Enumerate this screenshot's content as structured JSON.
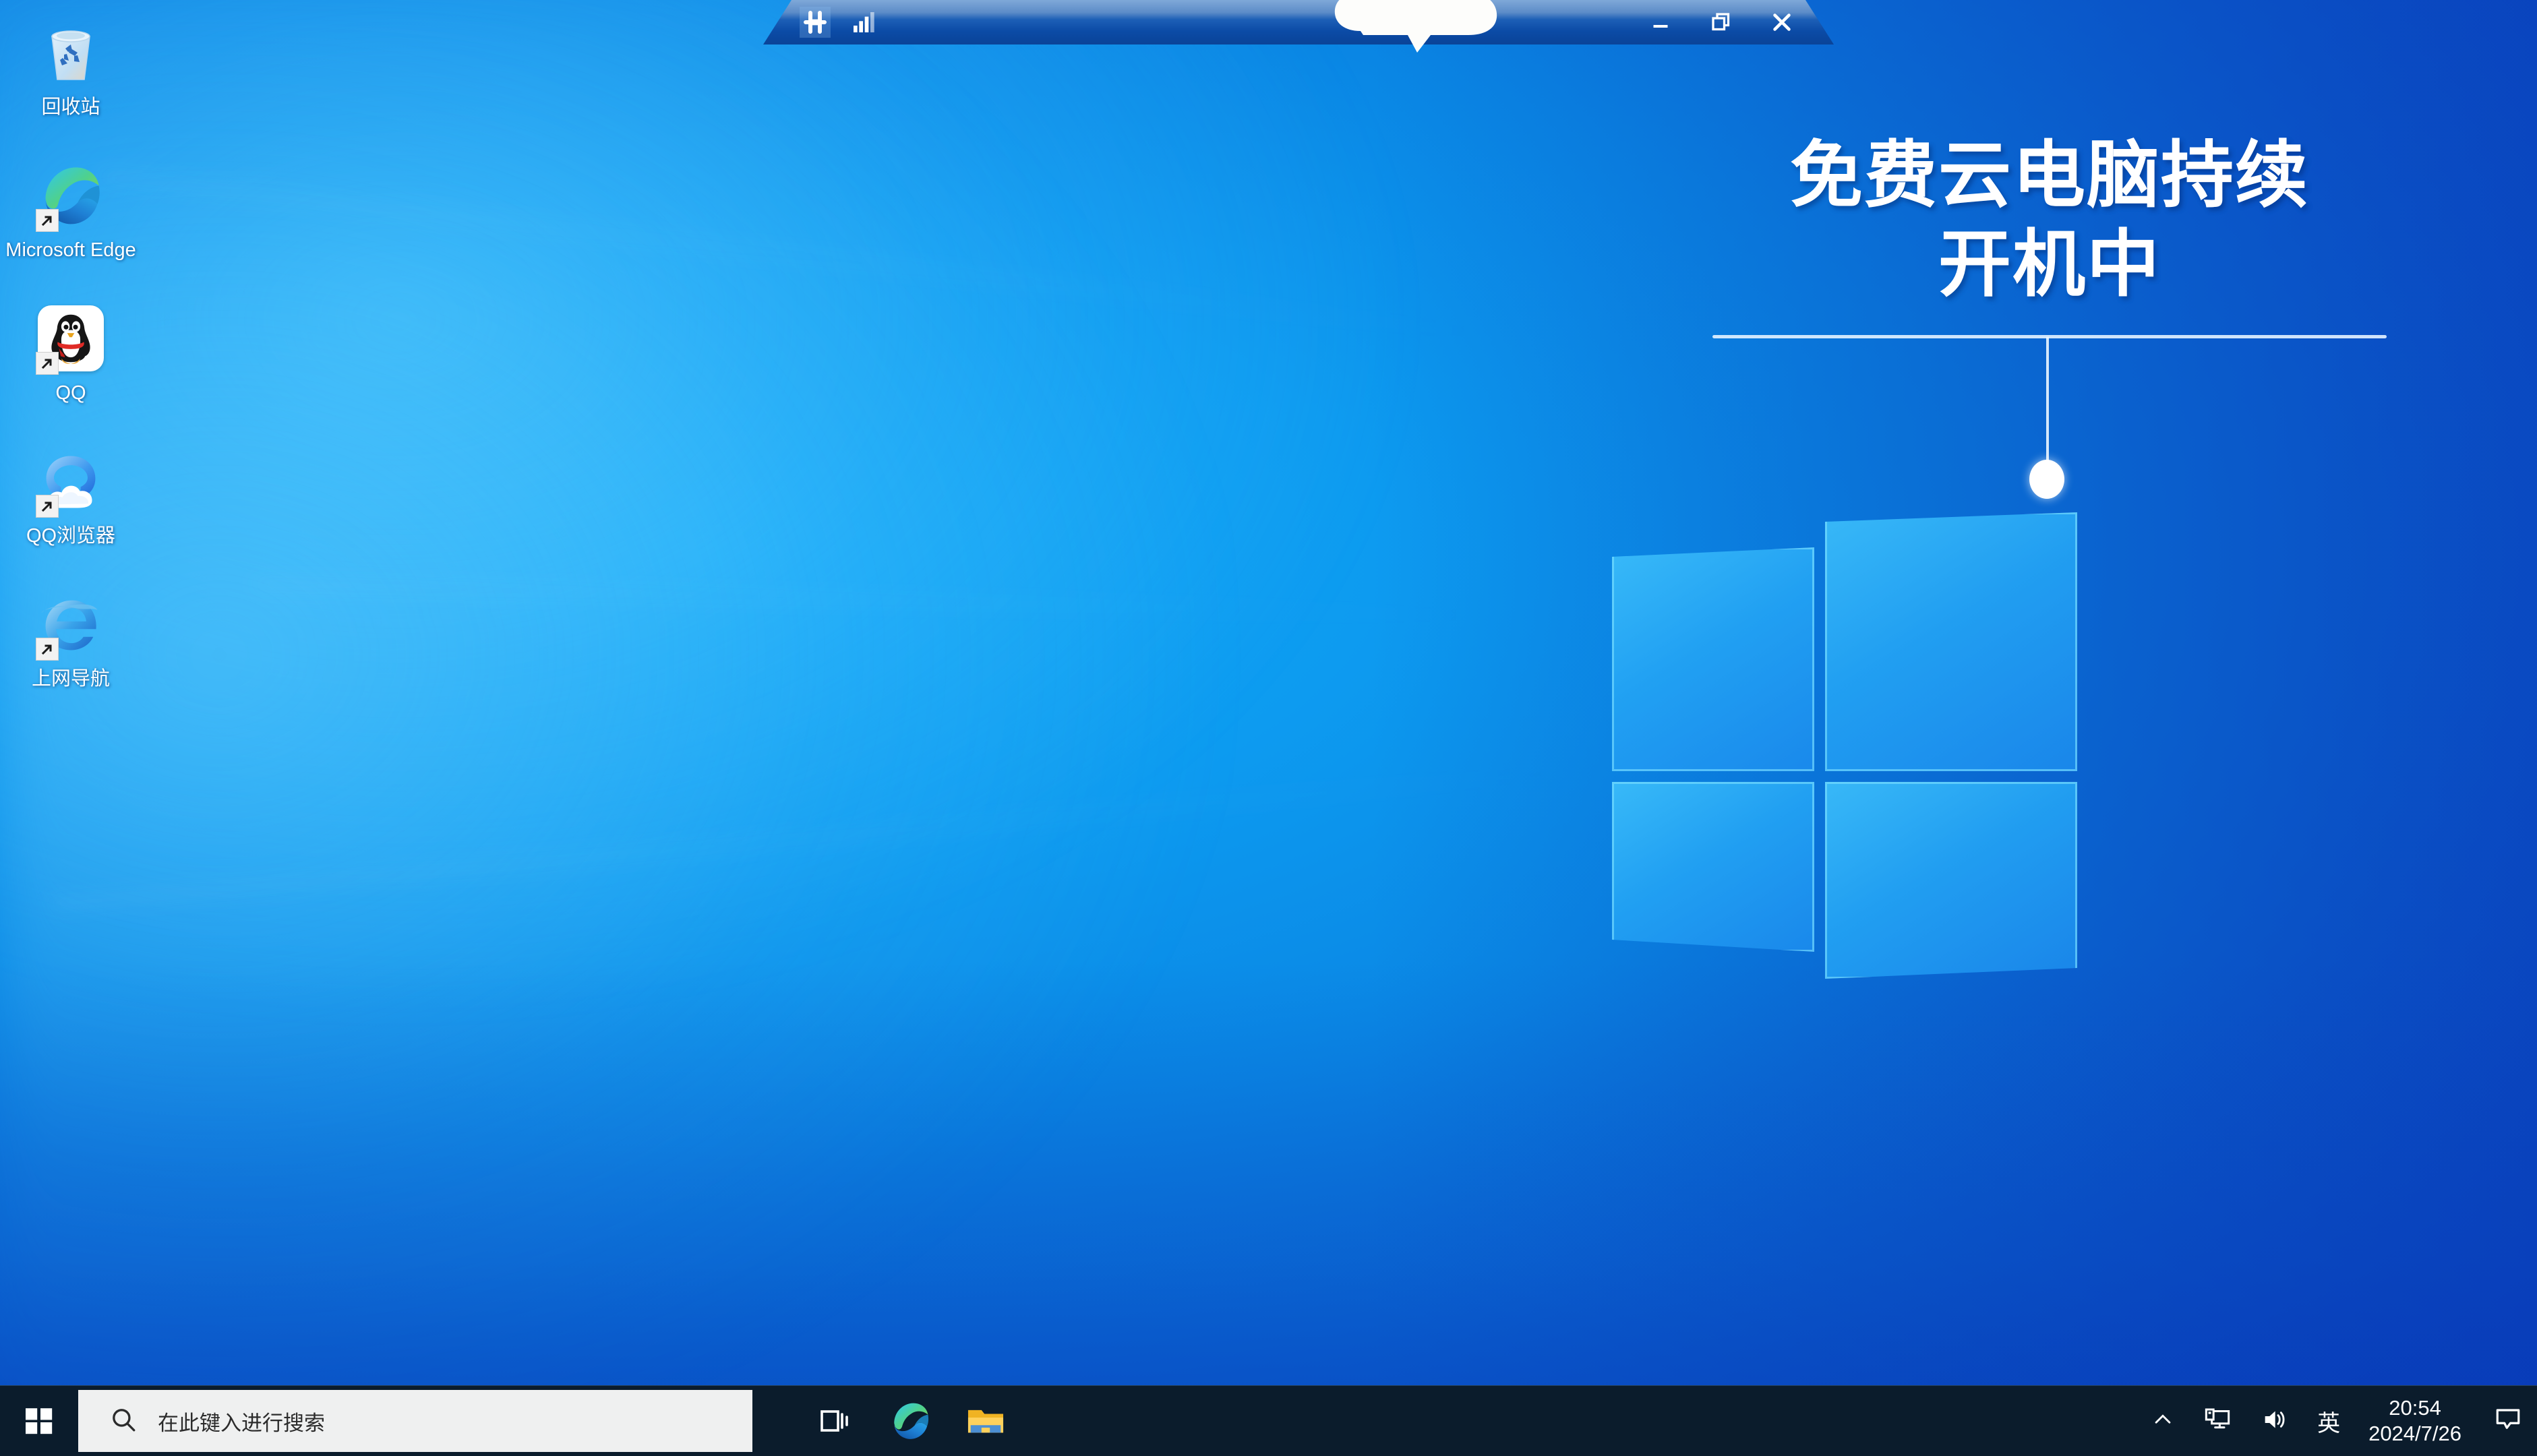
{
  "desktop": {
    "wallpaper_overlay": {
      "headline": "免费云电脑持续\n开机中",
      "logo_name": "windows-logo-watermark"
    },
    "icons": [
      {
        "label": "回收站",
        "icon": "recycle-bin-icon",
        "shortcut": false
      },
      {
        "label": "Microsoft Edge",
        "icon": "microsoft-edge-icon",
        "shortcut": true
      },
      {
        "label": "QQ",
        "icon": "qq-penguin-icon",
        "shortcut": true
      },
      {
        "label": "QQ浏览器",
        "icon": "qq-browser-icon",
        "shortcut": true
      },
      {
        "label": "上网导航",
        "icon": "internet-explorer-icon",
        "shortcut": true
      }
    ]
  },
  "topbar": {
    "left_buttons": [
      {
        "name": "pin-icon",
        "label": "Pin"
      },
      {
        "name": "signal-bars-icon",
        "label": "Signal"
      }
    ],
    "window_controls": [
      {
        "name": "minimize-button",
        "label": "–"
      },
      {
        "name": "restore-button",
        "label": "❐"
      },
      {
        "name": "close-button",
        "label": "✕"
      }
    ],
    "cloud_badge": "cloud-icon"
  },
  "taskbar": {
    "start": {
      "name": "start-button",
      "label": "开始"
    },
    "search": {
      "placeholder": "在此键入进行搜索",
      "value": "",
      "icon": "search-icon"
    },
    "apps": [
      {
        "name": "task-view-button",
        "label": "任务视图",
        "icon": "task-view-icon"
      },
      {
        "name": "taskbar-edge",
        "label": "Microsoft Edge",
        "icon": "microsoft-edge-icon"
      },
      {
        "name": "taskbar-file-explorer",
        "label": "文件资源管理器",
        "icon": "folder-icon"
      }
    ],
    "tray": {
      "overflow": {
        "name": "show-hidden-icons",
        "icon": "chevron-up-icon"
      },
      "network": {
        "name": "network-icon",
        "icon": "monitor-network-icon"
      },
      "volume": {
        "name": "volume-icon",
        "icon": "speaker-icon"
      },
      "ime": {
        "name": "ime-indicator",
        "label": "英"
      },
      "clock": {
        "time": "20:54",
        "date": "2024/7/26"
      },
      "notifications": {
        "name": "action-center-button",
        "icon": "speech-bubble-icon"
      }
    }
  },
  "colors": {
    "wallpaper_light": "#13a9f7",
    "wallpaper_dark": "#0a46bd",
    "taskbar": "#0b1c2c",
    "search_field": "#eff0f0",
    "accent_text": "#ffffff"
  }
}
